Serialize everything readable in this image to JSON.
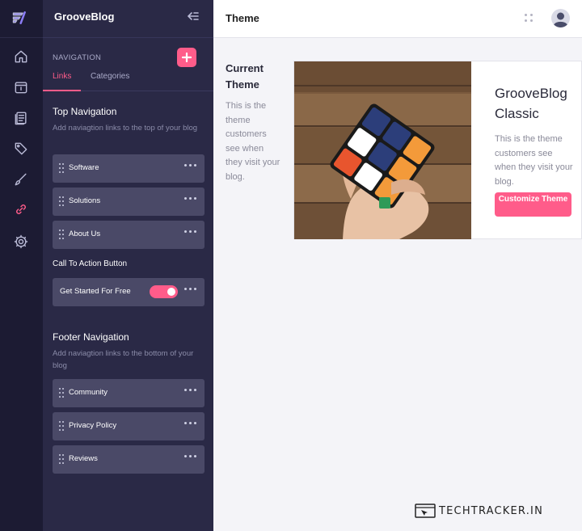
{
  "app": {
    "name": "GrooveBlog"
  },
  "colors": {
    "rail_bg": "#1c1b33",
    "sidebar_bg": "#2a2946",
    "item_bg": "#4a4967",
    "accent": "#ff5c8a",
    "main_bg": "#f4f4f8"
  },
  "rail": {
    "items": [
      {
        "icon": "home-icon"
      },
      {
        "icon": "calendar-icon"
      },
      {
        "icon": "document-icon"
      },
      {
        "icon": "tag-icon"
      },
      {
        "icon": "brush-icon"
      },
      {
        "icon": "link-icon",
        "active": true
      },
      {
        "icon": "settings-icon"
      }
    ]
  },
  "sidebar": {
    "navigation_label": "NAVIGATION",
    "tabs": [
      {
        "label": "Links",
        "active": true
      },
      {
        "label": "Categories",
        "active": false
      }
    ],
    "top_nav": {
      "title": "Top Navigation",
      "description": "Add naviagtion links to the top of your blog",
      "items": [
        {
          "label": "Software"
        },
        {
          "label": "Solutions"
        },
        {
          "label": "About Us"
        }
      ]
    },
    "cta": {
      "title": "Call To Action Button",
      "label": "Get Started For Free",
      "enabled": true
    },
    "footer_nav": {
      "title": "Footer Navigation",
      "description": "Add naviagtion links to the bottom of your blog",
      "items": [
        {
          "label": "Community"
        },
        {
          "label": "Privacy Policy"
        },
        {
          "label": "Reviews"
        }
      ]
    }
  },
  "header": {
    "title": "Theme"
  },
  "current_theme": {
    "title": "Current Theme",
    "description": "This is the theme customers see when they visit your blog.",
    "theme_name": "GrooveBlog Classic",
    "theme_description": "This is the theme customers see when they visit your blog.",
    "customize_label": "Customize Theme"
  },
  "watermark": {
    "text": "TECHTRACKER.IN"
  }
}
